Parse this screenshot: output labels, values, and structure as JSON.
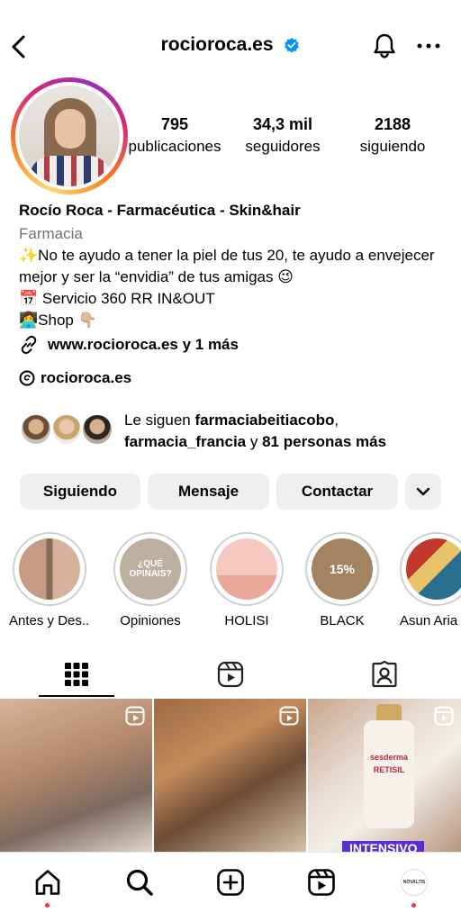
{
  "header": {
    "username": "rocioroca.es"
  },
  "stats": {
    "posts_count": "795",
    "posts_label": "publicaciones",
    "followers_count": "34,3 mil",
    "followers_label": "seguidores",
    "following_count": "2188",
    "following_label": "siguiendo"
  },
  "bio": {
    "name": "Rocío Roca - Farmacéutica - Skin&hair",
    "category": "Farmacia",
    "line1": "✨No te ayudo a tener la piel de tus 20, te ayudo a envejecer mejor y ser la “envidia” de tus amigas 😉",
    "line2": "📅 Servicio 360 RR IN&OUT",
    "line3": "👩‍💻Shop 👇🏼",
    "link": "www.rocioroca.es y 1 más",
    "threads": "rocioroca.es"
  },
  "followed_by": {
    "prefix": "Le siguen ",
    "user1": "farmaciabeitiacobo",
    "sep": ",",
    "user2": "farmacia_francia",
    "middle": " y ",
    "rest": "81 personas más"
  },
  "actions": {
    "following": "Siguiendo",
    "message": "Mensaje",
    "contact": "Contactar"
  },
  "highlights": [
    {
      "label": "Antes y Des..."
    },
    {
      "label": "Opiniones",
      "cover_text": "¿QUÉ OPINAIS?"
    },
    {
      "label": "HOLISI"
    },
    {
      "label": "BLACK",
      "cover_text": "15%"
    },
    {
      "label": "Asun Aria"
    }
  ],
  "posts": {
    "post3_brand": "sesderma",
    "post3_product": "RETISIL",
    "post3_caption": "INTENSIVO"
  },
  "colors": {
    "verified": "#0095f6",
    "notification_dot": "#ff3040",
    "button_bg": "#efefef",
    "category_text": "#737373"
  },
  "icons": {
    "header": [
      "chevron-left-icon",
      "verified-badge-icon",
      "bell-icon",
      "more-icon"
    ],
    "tabs": [
      "grid-icon",
      "reels-icon",
      "tagged-icon"
    ],
    "nav": [
      "home-icon",
      "search-icon",
      "create-icon",
      "reels-icon",
      "profile-avatar-icon"
    ]
  },
  "nav": {
    "profile_avatar_text": "NOVALTIS"
  }
}
